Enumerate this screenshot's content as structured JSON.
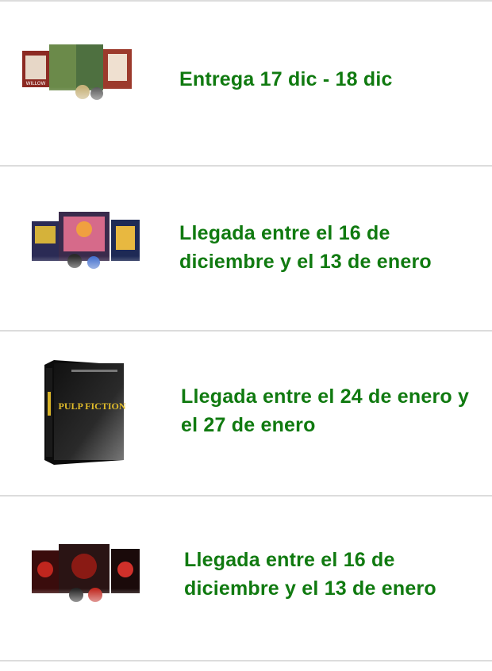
{
  "items": [
    {
      "image_icon": "bluray-steelbook-willow-product-image",
      "delivery_text": "Entrega 17 dic - 18 dic"
    },
    {
      "image_icon": "bluray-steelbook-collection-product-image",
      "delivery_text": "Llegada entre el 16 de diciembre y el 13 de enero"
    },
    {
      "image_icon": "pulp-fiction-4k-box-product-image",
      "delivery_text": "Llegada entre el 24 de enero y el 27 de enero"
    },
    {
      "image_icon": "bluray-steelbook-red-product-image",
      "delivery_text": "Llegada entre el 16 de diciembre y el 13 de enero"
    }
  ],
  "colors": {
    "delivery_green": "#107a10",
    "divider": "#dcdcdc"
  }
}
